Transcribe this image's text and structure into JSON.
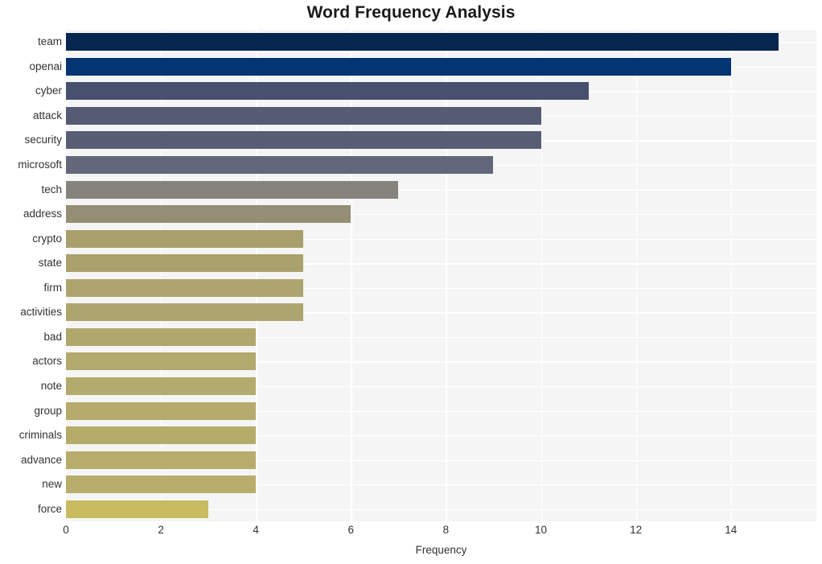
{
  "chart_data": {
    "type": "bar",
    "orientation": "horizontal",
    "title": "Word Frequency Analysis",
    "xlabel": "Frequency",
    "ylabel": "",
    "categories": [
      "team",
      "openai",
      "cyber",
      "attack",
      "security",
      "microsoft",
      "tech",
      "address",
      "crypto",
      "state",
      "firm",
      "activities",
      "bad",
      "actors",
      "note",
      "group",
      "criminals",
      "advance",
      "new",
      "force"
    ],
    "values": [
      15,
      14,
      11,
      10,
      10,
      9,
      7,
      6,
      5,
      5,
      5,
      5,
      4,
      4,
      4,
      4,
      4,
      4,
      4,
      3
    ],
    "bar_colors": [
      "#04264f",
      "#033572",
      "#47506e",
      "#555b72",
      "#585d74",
      "#64677a",
      "#85847c",
      "#938e74",
      "#a89f6d",
      "#aaa16d",
      "#ada46e",
      "#aea56e",
      "#b0a76d",
      "#b2a96d",
      "#b3aa6d",
      "#b4ab6c",
      "#b5ac6c",
      "#b6ad6c",
      "#b7ae6c",
      "#c9bb5f"
    ],
    "xlim": [
      0,
      15.8
    ],
    "xticks": [
      0,
      2,
      4,
      6,
      8,
      10,
      12,
      14
    ],
    "xtick_labels": [
      "0",
      "2",
      "4",
      "6",
      "8",
      "10",
      "12",
      "14"
    ],
    "grid": true,
    "grid_color": "#ffffff",
    "plot_background": "#f5f5f5",
    "figure_background": "#ffffff",
    "legend": null
  }
}
